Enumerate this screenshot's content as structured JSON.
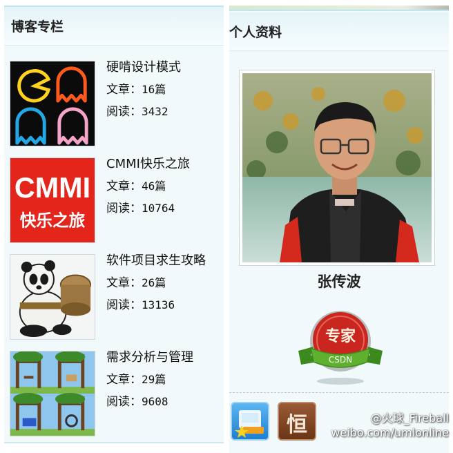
{
  "blog_columns": {
    "title": "博客专栏",
    "items": [
      {
        "name": "硬啃设计模式",
        "articles_label": "文章：",
        "articles": "16篇",
        "reads_label": "阅读：",
        "reads": "3432",
        "thumb_icon": "pacman-ghosts-icon"
      },
      {
        "name": "CMMI快乐之旅",
        "articles_label": "文章：",
        "articles": "46篇",
        "reads_label": "阅读：",
        "reads": "10764",
        "thumb_icon": "cmmi-logo",
        "thumb_text_top": "CMMI",
        "thumb_text_bottom": "快乐之旅"
      },
      {
        "name": "软件项目求生攻略",
        "articles_label": "文章：",
        "articles": "26篇",
        "reads_label": "阅读：",
        "reads": "13136",
        "thumb_icon": "kungfu-panda-icon"
      },
      {
        "name": "需求分析与管理",
        "articles_label": "文章：",
        "articles": "29篇",
        "reads_label": "阅读：",
        "reads": "9608",
        "thumb_icon": "playground-trees-icon"
      }
    ]
  },
  "profile": {
    "title": "个人资料",
    "name": "张传波",
    "badge": {
      "main": "专家",
      "ribbon": "CSDN"
    },
    "icons": [
      {
        "icon": "blog-medal-icon"
      },
      {
        "icon": "persistence-icon",
        "glyph": "恒"
      }
    ]
  },
  "watermark": {
    "handle": "@火球_Fireball",
    "url": "weibo.com/umlonline"
  },
  "colors": {
    "panel_bg": "#f1f9fb",
    "header_border": "#bfe6ef",
    "cmmi_red": "#e3251c",
    "badge_red": "#c8261f",
    "badge_green": "#4c9a2a"
  }
}
